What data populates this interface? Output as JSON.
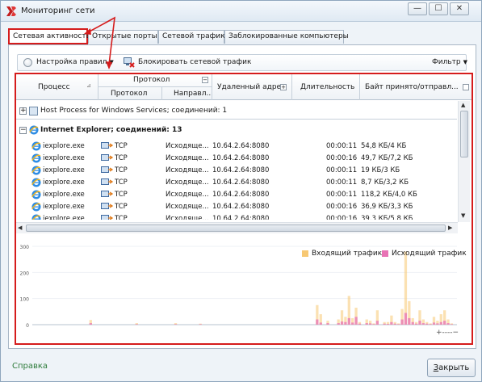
{
  "window": {
    "title": "Мониторинг сети",
    "controls": {
      "minimize": "—",
      "maximize": "☐",
      "close": "✕"
    }
  },
  "tabs": [
    {
      "label": "Сетевая активность",
      "active": true
    },
    {
      "label": "Открытые порты",
      "active": false
    },
    {
      "label": "Сетевой трафик",
      "active": false
    },
    {
      "label": "Заблокированные компьютеры",
      "active": false
    }
  ],
  "toolbar": {
    "rules_setting": "Настройка правил",
    "block_traffic": "Блокировать сетевой трафик",
    "filter": "Фильтр"
  },
  "grid": {
    "headers": {
      "process": "Процесс",
      "protocol_group": "Протокол",
      "protocol": "Протокол",
      "direction": "Направл...",
      "remote_address": "Удаленный адрес",
      "duration": "Длительность",
      "bytes": "Байт принято/отправл..."
    },
    "groups": [
      {
        "label": "Host Process for Windows Services; соединений: 1",
        "expander": "+",
        "bold": false
      },
      {
        "label": "Internet Explorer; соединений: 13",
        "expander": "−",
        "bold": true
      }
    ],
    "rows": [
      {
        "process": "iexplore.exe",
        "protocol": "TCP",
        "direction": "Исходяще...",
        "address": "10.64.2.64:8080",
        "duration": "00:00:11",
        "bytes": "54,8 КБ/4 КБ"
      },
      {
        "process": "iexplore.exe",
        "protocol": "TCP",
        "direction": "Исходяще...",
        "address": "10.64.2.64:8080",
        "duration": "00:00:16",
        "bytes": "49,7 КБ/7,2 КБ"
      },
      {
        "process": "iexplore.exe",
        "protocol": "TCP",
        "direction": "Исходяще...",
        "address": "10.64.2.64:8080",
        "duration": "00:00:11",
        "bytes": "19 КБ/3 КБ"
      },
      {
        "process": "iexplore.exe",
        "protocol": "TCP",
        "direction": "Исходяще...",
        "address": "10.64.2.64:8080",
        "duration": "00:00:11",
        "bytes": "8,7 КБ/3,2 КБ"
      },
      {
        "process": "iexplore.exe",
        "protocol": "TCP",
        "direction": "Исходяще...",
        "address": "10.64.2.64:8080",
        "duration": "00:00:11",
        "bytes": "118,2 КБ/4,0 КБ"
      },
      {
        "process": "iexplore.exe",
        "protocol": "TCP",
        "direction": "Исходяще...",
        "address": "10.64.2.64:8080",
        "duration": "00:00:16",
        "bytes": "36,9 КБ/3,3 КБ"
      },
      {
        "process": "iexplore.exe",
        "protocol": "TCP",
        "direction": "Исходяще...",
        "address": "10.64.2.64:8080",
        "duration": "00:00:16",
        "bytes": "39,3 КБ/5,8 КБ"
      }
    ]
  },
  "chart_data": {
    "type": "bar",
    "ylim": [
      0,
      300
    ],
    "yticks": [
      "300",
      "200",
      "100",
      "0"
    ],
    "legend_placement": "top-right",
    "series": [
      {
        "name": "Входящий трафик",
        "color": "#f7c873",
        "values": [
          0,
          0,
          0,
          0,
          0,
          0,
          0,
          0,
          0,
          0,
          0,
          0,
          0,
          0,
          0,
          0,
          18,
          0,
          0,
          0,
          0,
          0,
          0,
          0,
          0,
          0,
          0,
          0,
          0,
          6,
          0,
          0,
          0,
          0,
          0,
          0,
          0,
          0,
          0,
          0,
          6,
          0,
          0,
          0,
          0,
          0,
          0,
          4,
          0,
          0,
          0,
          0,
          0,
          0,
          0,
          0,
          0,
          0,
          0,
          0,
          0,
          0,
          0,
          0,
          0,
          0,
          0,
          0,
          0,
          0,
          0,
          0,
          0,
          0,
          0,
          0,
          0,
          0,
          0,
          0,
          75,
          40,
          0,
          15,
          0,
          0,
          20,
          55,
          30,
          110,
          25,
          65,
          10,
          0,
          20,
          15,
          5,
          55,
          0,
          10,
          10,
          35,
          10,
          5,
          60,
          280,
          90,
          25,
          10,
          55,
          20,
          10,
          5,
          30,
          15,
          40,
          55,
          20,
          5,
          0
        ]
      },
      {
        "name": "Исходящий трафик",
        "color": "#e873b5",
        "values": [
          0,
          0,
          0,
          0,
          0,
          0,
          0,
          0,
          0,
          0,
          0,
          0,
          0,
          0,
          0,
          0,
          6,
          0,
          0,
          0,
          0,
          0,
          0,
          0,
          0,
          0,
          0,
          0,
          0,
          2,
          0,
          0,
          0,
          0,
          0,
          0,
          0,
          0,
          0,
          0,
          2,
          0,
          0,
          0,
          0,
          0,
          0,
          2,
          0,
          0,
          0,
          0,
          0,
          0,
          0,
          0,
          0,
          0,
          0,
          0,
          0,
          0,
          0,
          0,
          0,
          0,
          0,
          0,
          0,
          0,
          0,
          0,
          0,
          0,
          0,
          0,
          0,
          0,
          0,
          0,
          20,
          8,
          0,
          6,
          0,
          0,
          6,
          12,
          10,
          25,
          8,
          30,
          4,
          0,
          6,
          5,
          2,
          15,
          0,
          4,
          3,
          10,
          4,
          2,
          20,
          45,
          25,
          10,
          4,
          15,
          6,
          4,
          2,
          8,
          5,
          10,
          15,
          6,
          2,
          0
        ]
      }
    ],
    "bar_color_hex": {
      "incoming": "#f7c873",
      "outgoing": "#e873b5"
    }
  },
  "chart_zoom": {
    "zoom_in": "+",
    "dashes": "----",
    "zoom_out": "−"
  },
  "footer": {
    "help": "Справка",
    "close_prefix": "",
    "close_underlined": "З",
    "close_rest": "акрыть"
  }
}
